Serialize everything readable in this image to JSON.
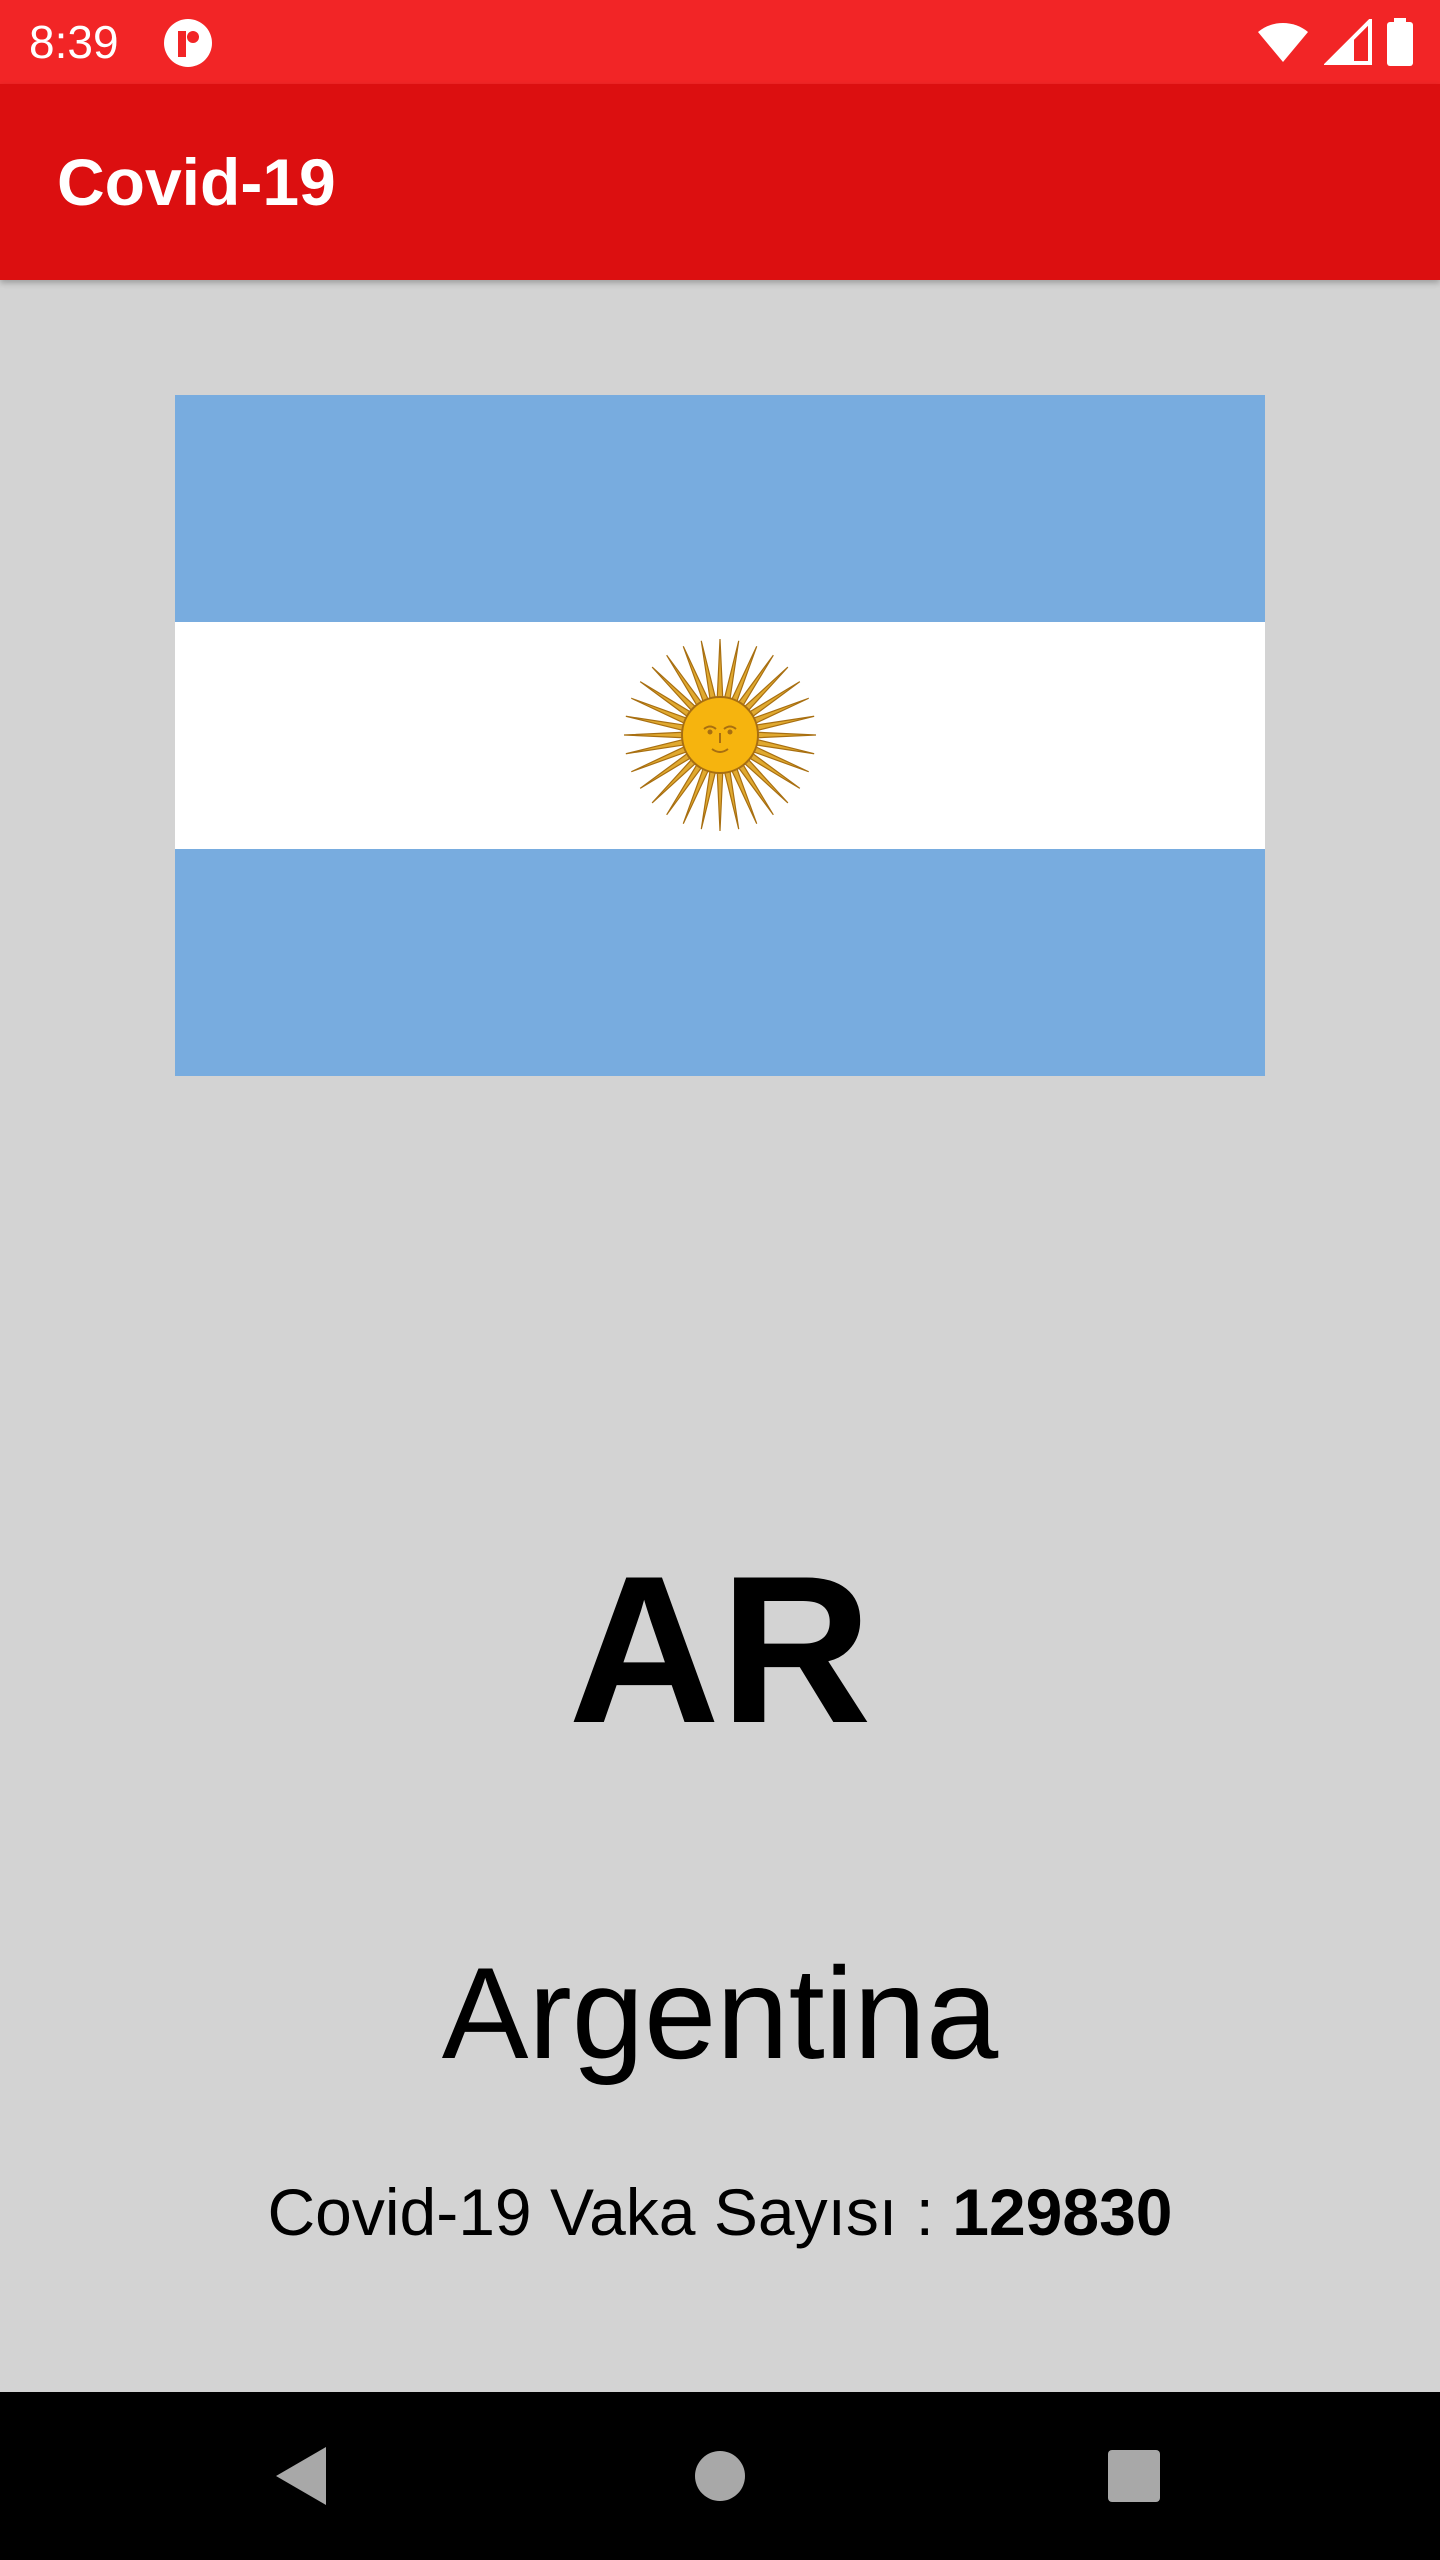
{
  "status_bar": {
    "time": "8:39",
    "icons": [
      "app-notification-icon",
      "wifi-icon",
      "cellular-signal-icon",
      "battery-icon"
    ],
    "background_color": "#f22526"
  },
  "app_bar": {
    "title": "Covid-19",
    "background_color": "#dc0f10"
  },
  "content": {
    "flag_country": "Argentina",
    "country_code": "AR",
    "country_name": "Argentina",
    "case_label": "Covid-19 Vaka Sayısı : ",
    "case_count": "129830",
    "background_color": "#d3d3d3"
  },
  "nav_bar": {
    "buttons": [
      "back-icon",
      "home-icon",
      "recents-icon"
    ]
  }
}
